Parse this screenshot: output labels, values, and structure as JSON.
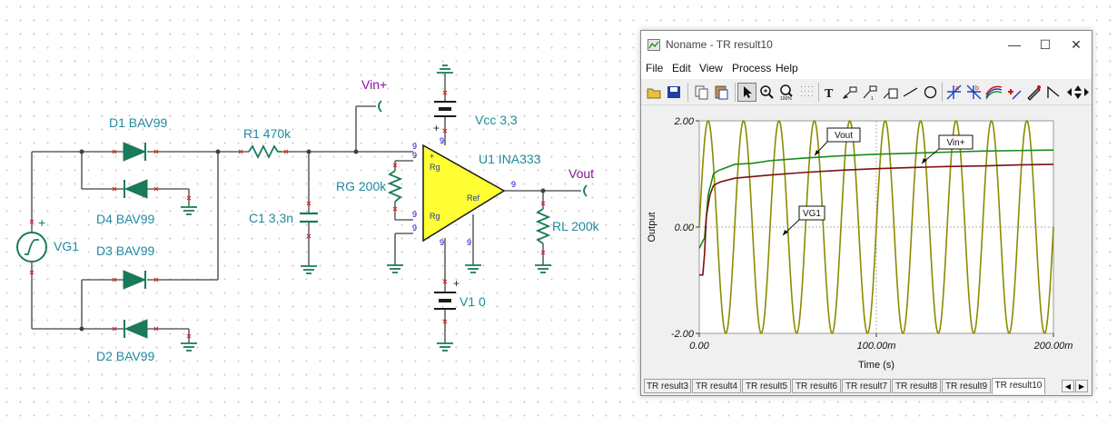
{
  "schematic": {
    "diodes": [
      {
        "label": "D1 BAV99"
      },
      {
        "label": "D4 BAV99"
      },
      {
        "label": "D3 BAV99"
      },
      {
        "label": "D2 BAV99"
      }
    ],
    "source": {
      "label": "VG1",
      "plus": "+"
    },
    "r1": "R1 470k",
    "c1": "C1 3,3n",
    "rg": "RG 200k",
    "rl": "RL 200k",
    "vcc": "Vcc 3,3",
    "v1": "V1 0",
    "amp": "U1 INA333",
    "vin_plus": "Vin+",
    "vout": "Vout",
    "pin_labels": {
      "rg": "Rg",
      "ref": "Ref",
      "plus": "+",
      "minus": "-"
    },
    "pin_numbers": {
      "nine": "9"
    }
  },
  "window": {
    "title": "Noname - TR result10",
    "icon": "chart-app-icon",
    "controls": {
      "minimize": "—",
      "maximize": "☐",
      "close": "✕"
    },
    "menu": [
      "File",
      "Edit",
      "View",
      "Process",
      "Help"
    ],
    "toolbar_icons": [
      "open-folder-icon",
      "save-disk-icon",
      "copy-icon",
      "paste-icon",
      "pointer-icon",
      "zoom-in-icon",
      "zoom-100-icon",
      "grid-icon",
      "text-icon",
      "annotate-arrow-icon",
      "annotate-arrow2-icon",
      "label-box-icon",
      "line-icon",
      "circle-icon",
      "cursor-a-icon",
      "cursor-b-icon",
      "curves-icon",
      "marker-icon",
      "pen-icon",
      "step-icon",
      "scroll-left-icon",
      "scroll-updown-icon",
      "scroll-right-icon"
    ],
    "tabs": [
      "TR result3",
      "TR result4",
      "TR result5",
      "TR result6",
      "TR result7",
      "TR result8",
      "TR result9",
      "TR result10"
    ],
    "active_tab": "TR result10"
  },
  "chart_data": {
    "type": "line",
    "xlabel": "Time (s)",
    "ylabel": "Output",
    "x_ticks": [
      "0.00",
      "100.00m",
      "200.00m"
    ],
    "y_ticks": [
      "2.00",
      "0.00",
      "-2.00"
    ],
    "xlim": [
      0,
      0.2
    ],
    "ylim": [
      -2,
      2
    ],
    "grid": true,
    "series": [
      {
        "name": "VG1",
        "kind": "sine",
        "amplitude": 2.0,
        "frequency_hz": 50,
        "color": "#8b8b00"
      },
      {
        "name": "Vout",
        "kind": "step-rise",
        "points": [
          [
            0.0,
            -0.4
          ],
          [
            0.003,
            -0.2
          ],
          [
            0.005,
            0.6
          ],
          [
            0.008,
            1.0
          ],
          [
            0.01,
            1.05
          ],
          [
            0.012,
            1.08
          ],
          [
            0.02,
            1.18
          ],
          [
            0.03,
            1.2
          ],
          [
            0.04,
            1.25
          ],
          [
            0.06,
            1.3
          ],
          [
            0.08,
            1.34
          ],
          [
            0.1,
            1.37
          ],
          [
            0.12,
            1.39
          ],
          [
            0.14,
            1.41
          ],
          [
            0.16,
            1.43
          ],
          [
            0.18,
            1.44
          ],
          [
            0.2,
            1.45
          ]
        ],
        "color": "#1a8a1a"
      },
      {
        "name": "Vin+",
        "kind": "step-rise",
        "points": [
          [
            0.0,
            -0.9
          ],
          [
            0.002,
            -0.9
          ],
          [
            0.003,
            -0.5
          ],
          [
            0.004,
            0.2
          ],
          [
            0.006,
            0.6
          ],
          [
            0.008,
            0.78
          ],
          [
            0.01,
            0.82
          ],
          [
            0.012,
            0.85
          ],
          [
            0.02,
            0.92
          ],
          [
            0.03,
            0.95
          ],
          [
            0.04,
            0.98
          ],
          [
            0.06,
            1.03
          ],
          [
            0.08,
            1.07
          ],
          [
            0.1,
            1.1
          ],
          [
            0.12,
            1.12
          ],
          [
            0.14,
            1.14
          ],
          [
            0.16,
            1.15
          ],
          [
            0.18,
            1.17
          ],
          [
            0.2,
            1.18
          ]
        ],
        "color": "#7a1010"
      }
    ],
    "annotations": [
      "Vout",
      "Vin+",
      "VG1"
    ]
  }
}
